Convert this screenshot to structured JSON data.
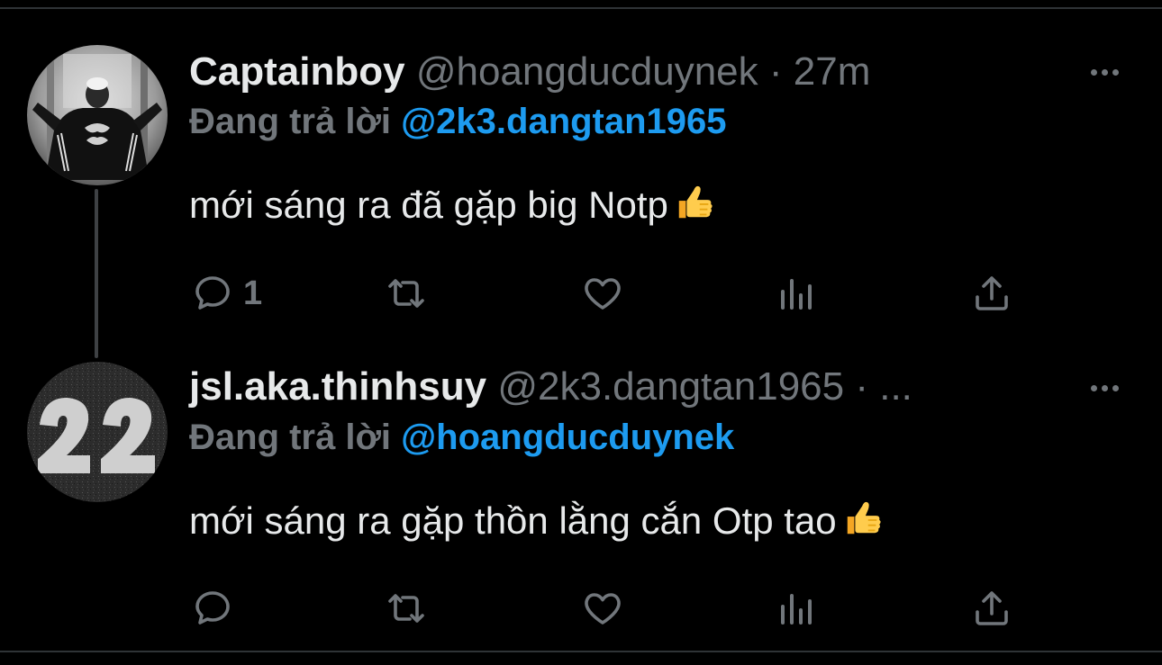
{
  "tweets": [
    {
      "display_name": "Captainboy",
      "handle": "@hoangducduynek",
      "separator": "·",
      "time": "27m",
      "reply_prefix": "Đang trả lời",
      "reply_to": "@2k3.dangtan1965",
      "text": "mới sáng ra đã gặp big Notp",
      "emoji": "thumbs-up-emoji",
      "reply_count": "1",
      "avatar": "person-in-black-jacket"
    },
    {
      "display_name": "jsl.aka.thinhsuy",
      "handle": "@2k3.dangtan1965",
      "separator": "·",
      "time": "...",
      "reply_prefix": "Đang trả lời",
      "reply_to": "@hoangducduynek",
      "text": "mới sáng ra gặp thồn lằng cắn Otp tao",
      "emoji": "thumbs-up-emoji",
      "reply_count": "",
      "avatar": "painted-number-22-on-asphalt"
    }
  ],
  "colors": {
    "background": "#000000",
    "text": "#e7e9ea",
    "secondary": "#71767b",
    "accent": "#1d9bf0",
    "thread_line": "#3e4144"
  },
  "icons": [
    "reply-icon",
    "retweet-icon",
    "like-icon",
    "views-icon",
    "share-icon",
    "more-icon"
  ]
}
